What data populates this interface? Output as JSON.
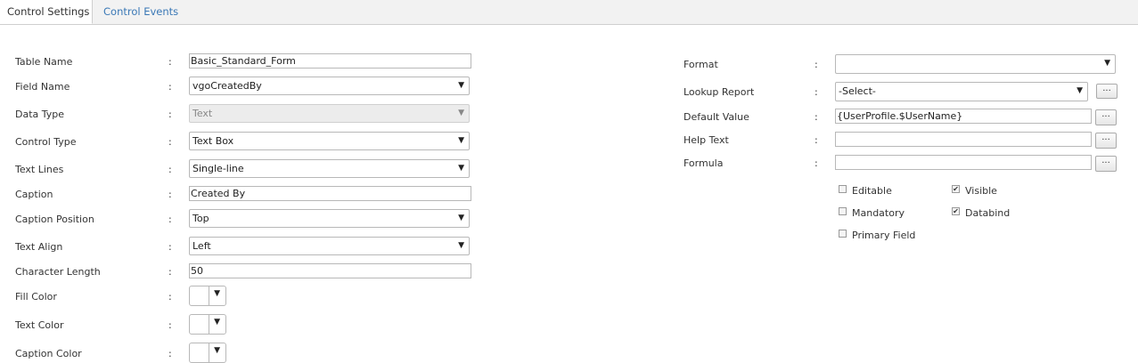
{
  "tabs": [
    {
      "label": "Control Settings",
      "active": true
    },
    {
      "label": "Control Events",
      "active": false
    }
  ],
  "left_fields": {
    "table_name": {
      "label": "Table Name",
      "value": "Basic_Standard_Form"
    },
    "field_name": {
      "label": "Field Name",
      "value": "vgoCreatedBy"
    },
    "data_type": {
      "label": "Data Type",
      "value": "Text",
      "disabled": true
    },
    "control_type": {
      "label": "Control Type",
      "value": "Text Box"
    },
    "text_lines": {
      "label": "Text Lines",
      "value": "Single-line"
    },
    "caption": {
      "label": "Caption",
      "value": "Created By"
    },
    "caption_position": {
      "label": "Caption Position",
      "value": "Top"
    },
    "text_align": {
      "label": "Text Align",
      "value": "Left"
    },
    "character_length": {
      "label": "Character Length",
      "value": "50"
    },
    "fill_color": {
      "label": "Fill Color"
    },
    "text_color": {
      "label": "Text Color"
    },
    "caption_color": {
      "label": "Caption Color"
    }
  },
  "right_fields": {
    "format": {
      "label": "Format",
      "value": ""
    },
    "lookup_report": {
      "label": "Lookup Report",
      "value": "-Select-"
    },
    "default_value": {
      "label": "Default Value",
      "value": "{UserProfile.$UserName}"
    },
    "help_text": {
      "label": "Help Text",
      "value": ""
    },
    "formula": {
      "label": "Formula",
      "value": ""
    }
  },
  "checkboxes": [
    {
      "label": "Editable",
      "checked": false
    },
    {
      "label": "Visible",
      "checked": true
    },
    {
      "label": "Mandatory",
      "checked": false
    },
    {
      "label": "Databind",
      "checked": true
    },
    {
      "label": "Primary Field",
      "checked": false
    }
  ],
  "common": {
    "colon": ":",
    "ellipsis": "...",
    "arrow": "▼",
    "check": "✔"
  }
}
